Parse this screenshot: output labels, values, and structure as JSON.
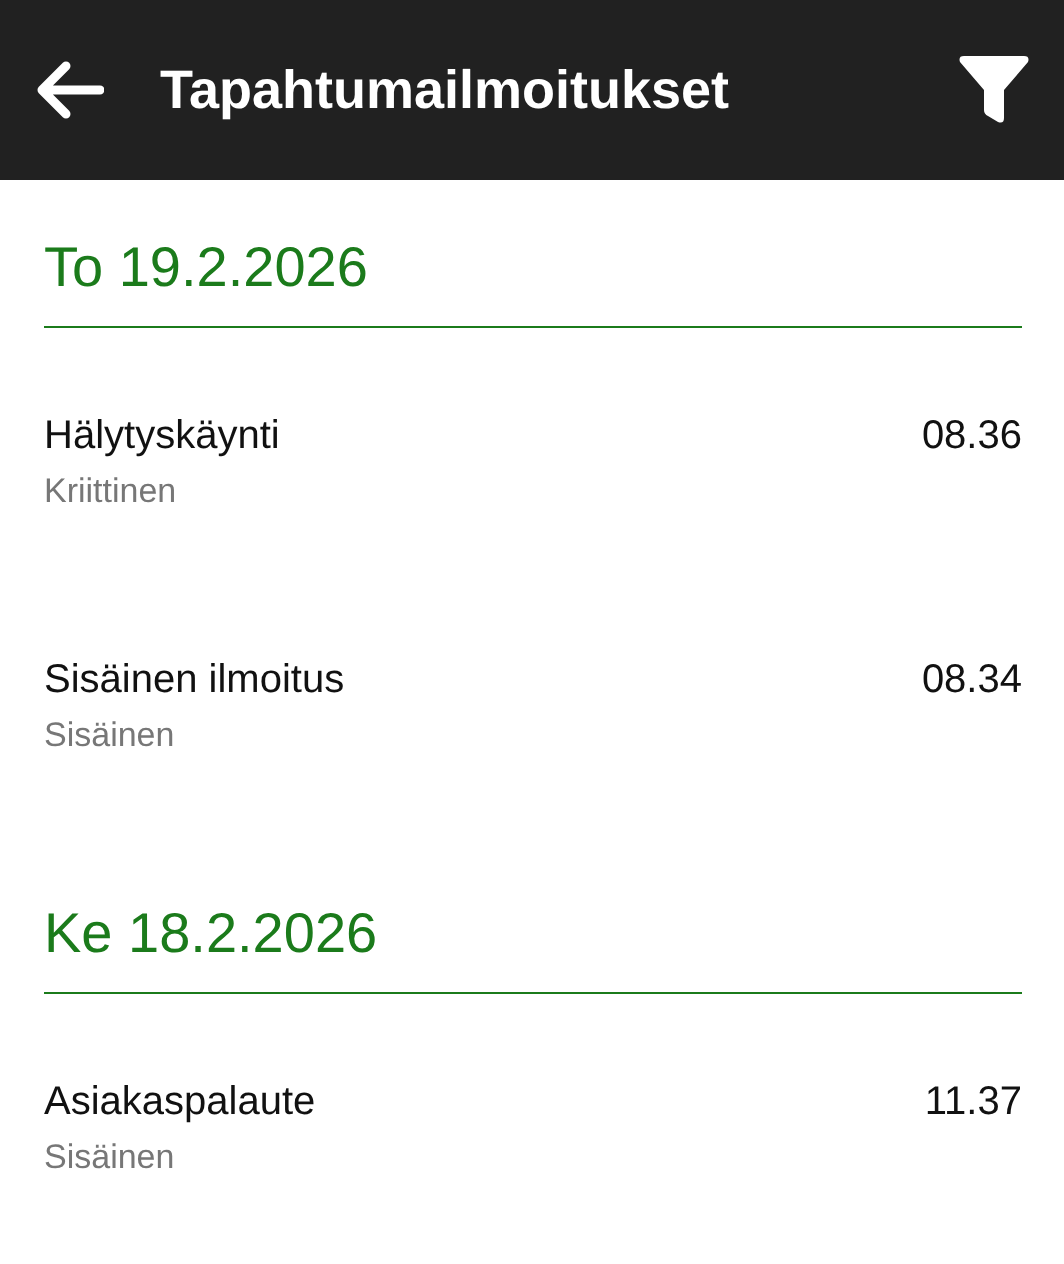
{
  "app_bar": {
    "title": "Tapahtumailmoitukset"
  },
  "sections": [
    {
      "date": "To 19.2.2026",
      "items": [
        {
          "title": "Hälytyskäynti",
          "category": "Kriittinen",
          "time": "08.36"
        },
        {
          "title": "Sisäinen ilmoitus",
          "category": "Sisäinen",
          "time": "08.34"
        }
      ]
    },
    {
      "date": "Ke 18.2.2026",
      "items": [
        {
          "title": "Asiakaspalaute",
          "category": "Sisäinen",
          "time": "11.37"
        }
      ]
    }
  ]
}
